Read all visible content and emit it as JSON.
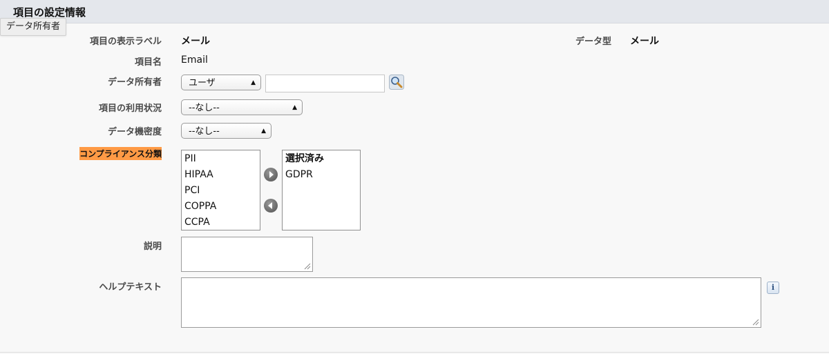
{
  "section": {
    "title": "項目の設定情報"
  },
  "tooltip": {
    "text": "データ所有者"
  },
  "fields": {
    "label_field": {
      "label": "項目の表示ラベル",
      "value": "メール"
    },
    "name_field": {
      "label": "項目名",
      "value": "Email"
    },
    "data_type": {
      "label": "データ型",
      "value": "メール"
    },
    "owner": {
      "label": "データ所有者",
      "type_select": "ユーザ",
      "input_value": ""
    },
    "usage": {
      "label": "項目の利用状況",
      "select": "--なし--"
    },
    "sensitivity": {
      "label": "データ機密度",
      "select": "--なし--"
    },
    "compliance": {
      "label": "コンプライアンス分類",
      "available": [
        "PII",
        "HIPAA",
        "PCI",
        "COPPA",
        "CCPA"
      ],
      "selected_header": "選択済み",
      "selected": [
        "GDPR"
      ]
    },
    "description": {
      "label": "説明",
      "value": ""
    },
    "help_text": {
      "label": "ヘルプテキスト",
      "value": ""
    }
  },
  "icons": {
    "lookup": "magnifier-lookup-icon",
    "add": "arrow-right-icon",
    "remove": "arrow-left-icon",
    "info": "info-icon",
    "info_glyph": "i"
  }
}
